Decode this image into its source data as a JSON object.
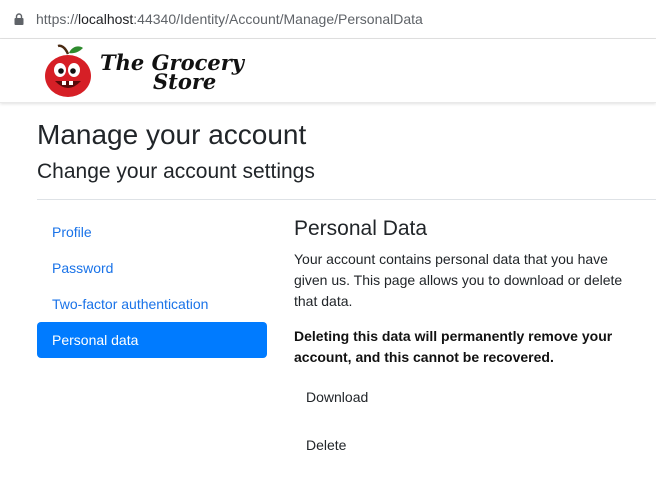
{
  "browser": {
    "url_prefix": "https://",
    "url_host": "localhost",
    "url_port_path": ":44340/Identity/Account/Manage/PersonalData"
  },
  "brand": {
    "line1": "The Grocery",
    "line2": "Store"
  },
  "page": {
    "title": "Manage your account",
    "subtitle": "Change your account settings"
  },
  "sidebar": {
    "items": [
      {
        "label": "Profile",
        "active": false
      },
      {
        "label": "Password",
        "active": false
      },
      {
        "label": "Two-factor authentication",
        "active": false
      },
      {
        "label": "Personal data",
        "active": true
      }
    ]
  },
  "main": {
    "heading": "Personal Data",
    "description": "Your account contains personal data that you have given us. This page allows you to download or delete that data.",
    "warning": "Deleting this data will permanently remove your account, and this cannot be recovered.",
    "download_label": "Download",
    "delete_label": "Delete"
  },
  "colors": {
    "accent": "#007bff",
    "link": "#1a73e8"
  }
}
